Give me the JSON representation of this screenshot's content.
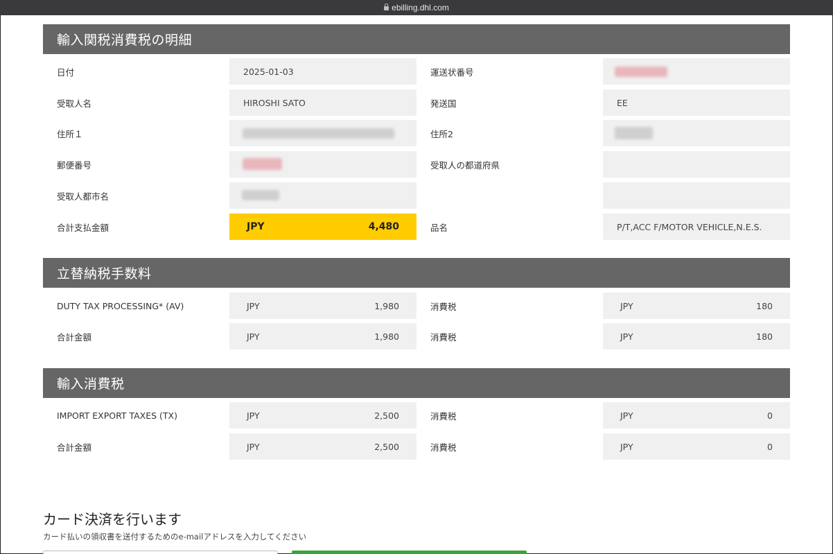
{
  "browser": {
    "url": "ebilling.dhl.com"
  },
  "section1": {
    "title": "輸入関税消費税の明細",
    "date_label": "日付",
    "date_value": "2025-01-03",
    "waybill_label": "運送状番号",
    "recipient_label": "受取人名",
    "recipient_value": "HIROSHI SATO",
    "origin_label": "発送国",
    "origin_value": "EE",
    "address1_label": "住所１",
    "address2_label": "住所2",
    "postal_label": "郵便番号",
    "prefecture_label": "受取人の都道府県",
    "city_label": "受取人都市名",
    "total_label": "合計支払金額",
    "total_currency": "JPY",
    "total_amount": "4,480",
    "item_label": "品名",
    "item_value": "P/T,ACC F/MOTOR VEHICLE,N.E.S."
  },
  "section2": {
    "title": "立替納税手数料",
    "rows": [
      {
        "label": "DUTY TAX PROCESSING* (AV)",
        "currency": "JPY",
        "amount": "1,980",
        "tax_label": "消費税",
        "tax_currency": "JPY",
        "tax_amount": "180"
      },
      {
        "label": "合計金額",
        "currency": "JPY",
        "amount": "1,980",
        "tax_label": "消費税",
        "tax_currency": "JPY",
        "tax_amount": "180"
      }
    ]
  },
  "section3": {
    "title": "輸入消費税",
    "rows": [
      {
        "label": "IMPORT EXPORT TAXES (TX)",
        "currency": "JPY",
        "amount": "2,500",
        "tax_label": "消費税",
        "tax_currency": "JPY",
        "tax_amount": "0"
      },
      {
        "label": "合計金額",
        "currency": "JPY",
        "amount": "2,500",
        "tax_label": "消費税",
        "tax_currency": "JPY",
        "tax_amount": "0"
      }
    ]
  },
  "payment": {
    "title": "カード決済を行います",
    "subtitle": "カード払いの領収書を送付するためのe-mailアドレスを入力してください"
  },
  "colors": {
    "header_bg": "#666666",
    "field_bg": "#f0f0f0",
    "total_highlight": "#ffcc00",
    "button_green": "#3aa33a"
  }
}
